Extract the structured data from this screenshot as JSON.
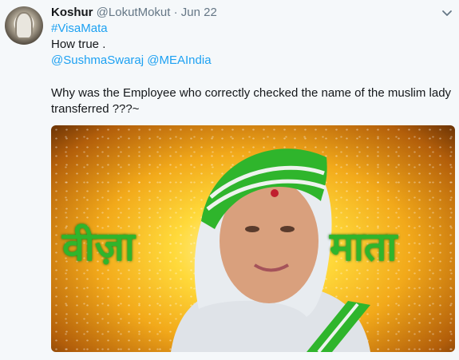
{
  "tweet": {
    "display_name": "Koshur",
    "handle": "@LokutMokut",
    "separator": "·",
    "time": "Jun 22",
    "hashtag": "#VisaMata",
    "text_line1": "How true .",
    "mention1": "@SushmaSwaraj",
    "mention2": "@MEAIndia",
    "text_line2": "Why was the Employee who correctly checked the name of the muslim lady",
    "text_line3": "transferred ???~"
  },
  "media": {
    "left_caption": "वीज़ा",
    "right_caption": "माता"
  },
  "icons": {
    "menu": "chevron-down-icon",
    "avatar": "avatar"
  },
  "colors": {
    "link": "#1da1f2",
    "caption": "#2fb52c",
    "background": "#f5f8fa"
  }
}
